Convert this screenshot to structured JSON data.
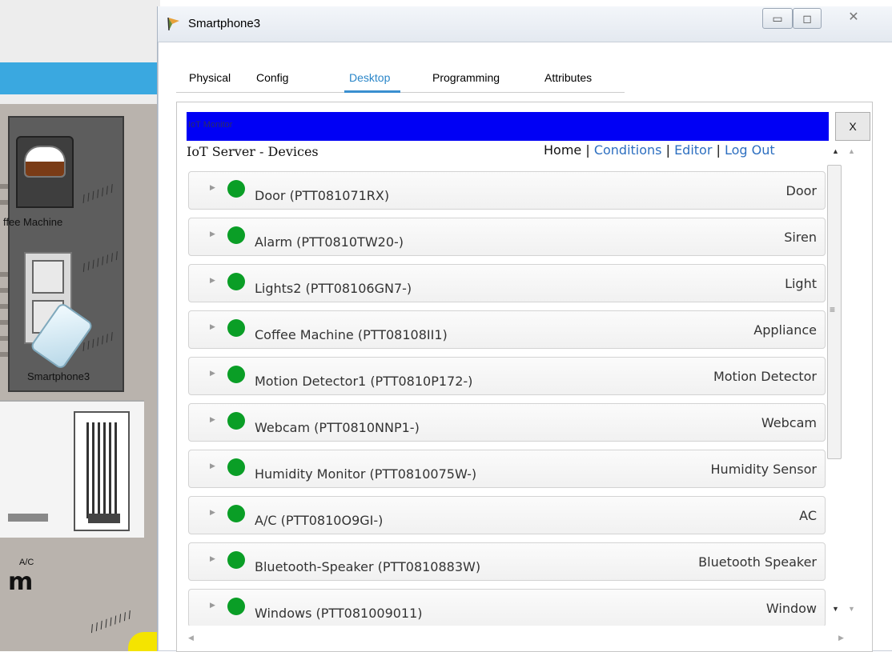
{
  "workspace": {
    "coffee_label": "ffee Machine",
    "phone_label": "Smartphone3",
    "ac_label": "A/C"
  },
  "window": {
    "title": "Smartphone3",
    "controls": {
      "minimize": "▭",
      "maximize": "◻",
      "close": "✕"
    }
  },
  "tabs": [
    {
      "label": "Physical",
      "active": false
    },
    {
      "label": "Config",
      "active": false
    },
    {
      "label": "Desktop",
      "active": true
    },
    {
      "label": "Programming",
      "active": false
    },
    {
      "label": "Attributes",
      "active": false
    }
  ],
  "iot": {
    "window_title": "IoT Monitor",
    "close_label": "X",
    "heading": "IoT Server - Devices",
    "nav": {
      "home": "Home",
      "sep": " | ",
      "conditions": "Conditions",
      "editor": "Editor",
      "logout": "Log Out"
    },
    "status_color": "#0a9e26",
    "devices": [
      {
        "name": "Door (PTT081071RX)",
        "type": "Door"
      },
      {
        "name": "Alarm (PTT0810TW20-)",
        "type": "Siren"
      },
      {
        "name": "Lights2 (PTT08106GN7-)",
        "type": "Light"
      },
      {
        "name": "Coffee Machine (PTT08108II1)",
        "type": "Appliance"
      },
      {
        "name": "Motion Detector1 (PTT0810P172-)",
        "type": "Motion Detector"
      },
      {
        "name": "Webcam (PTT0810NNP1-)",
        "type": "Webcam"
      },
      {
        "name": "Humidity Monitor (PTT0810075W-)",
        "type": "Humidity Sensor"
      },
      {
        "name": "A/C (PTT0810O9GI-)",
        "type": "AC"
      },
      {
        "name": "Bluetooth-Speaker (PTT0810883W)",
        "type": "Bluetooth Speaker"
      },
      {
        "name": "Windows (PTT081009011)",
        "type": "Window"
      }
    ]
  }
}
